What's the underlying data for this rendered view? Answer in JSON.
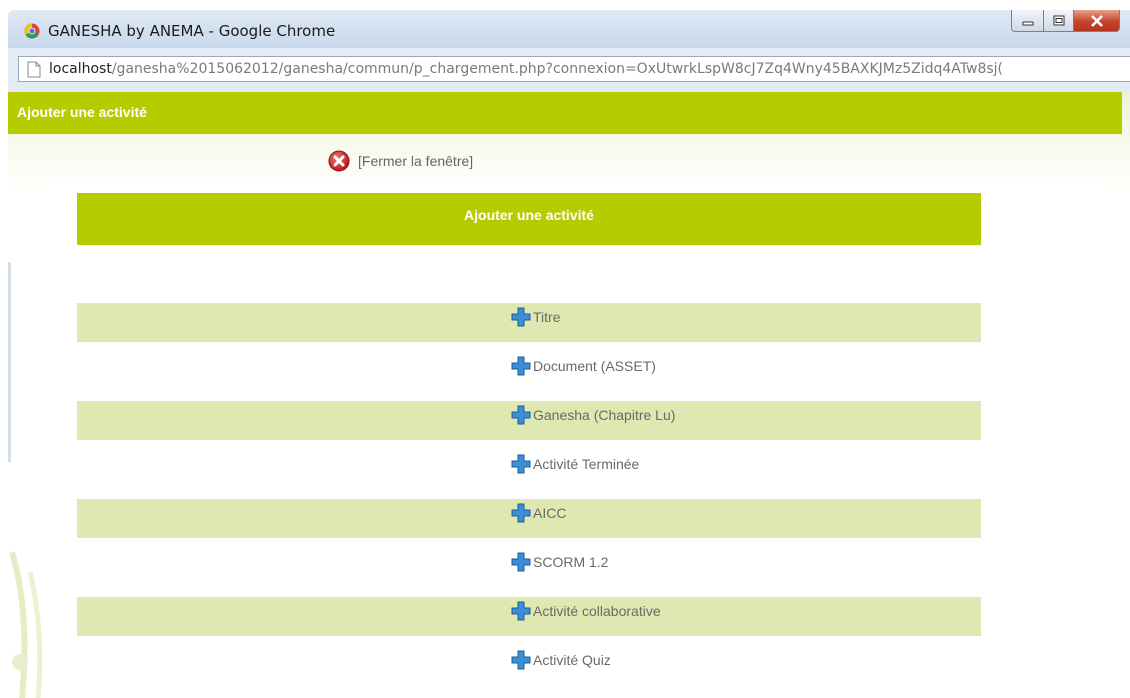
{
  "window": {
    "title": "GANESHA by ANEMA - Google Chrome",
    "url_host": "localhost",
    "url_path": "/ganesha%2015062012/ganesha/commun/p_chargement.php?connexion=OxUtwrkLspW8cJ7Zq4Wny45BAXKJMz5Zidq4ATw8sj("
  },
  "header": {
    "title": "Ajouter une activité"
  },
  "close_link": {
    "label": "[Fermer la fenêtre]"
  },
  "panel": {
    "title": "Ajouter une activité",
    "items": [
      {
        "label": "Titre",
        "shaded": true
      },
      {
        "label": "Document (ASSET)",
        "shaded": false
      },
      {
        "label": "Ganesha (Chapitre Lu)",
        "shaded": true
      },
      {
        "label": "Activité Terminée",
        "shaded": false
      },
      {
        "label": "AICC",
        "shaded": true
      },
      {
        "label": "SCORM 1.2",
        "shaded": false
      },
      {
        "label": "Activité collaborative",
        "shaded": true
      },
      {
        "label": "Activité Quiz",
        "shaded": false
      }
    ]
  },
  "colors": {
    "accent": "#b6cb00",
    "row_shade": "#dee8b0",
    "plus_icon": "#3c8fd6",
    "close_icon": "#cc2222"
  },
  "icons": {
    "add": "plus-icon",
    "close": "close-circle-icon",
    "browser": "chrome-icon"
  }
}
